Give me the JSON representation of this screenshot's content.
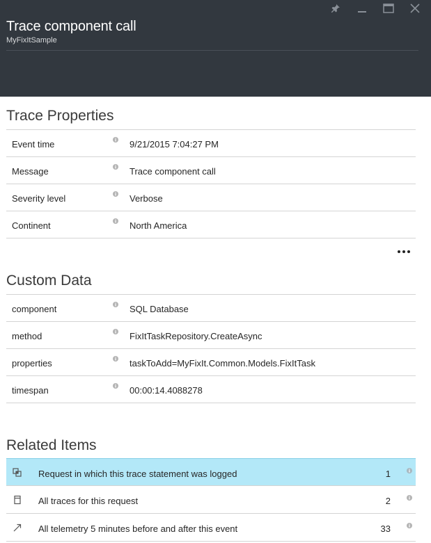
{
  "header": {
    "title": "Trace component call",
    "subtitle": "MyFixItSample",
    "controls": [
      "pin-icon",
      "minimize-icon",
      "maximize-icon",
      "close-icon"
    ]
  },
  "trace_properties": {
    "title": "Trace Properties",
    "rows": [
      {
        "label": "Event time",
        "value": "9/21/2015 7:04:27 PM"
      },
      {
        "label": "Message",
        "value": "Trace component call"
      },
      {
        "label": "Severity level",
        "value": "Verbose"
      },
      {
        "label": "Continent",
        "value": "North America"
      }
    ],
    "more_icon": "ellipsis-icon"
  },
  "custom_data": {
    "title": "Custom Data",
    "rows": [
      {
        "label": "component",
        "value": "SQL Database"
      },
      {
        "label": "method",
        "value": "FixItTaskRepository.CreateAsync"
      },
      {
        "label": "properties",
        "value": "taskToAdd=MyFixIt.Common.Models.FixItTask"
      },
      {
        "label": "timespan",
        "value": "00:00:14.4088278"
      }
    ]
  },
  "related_items": {
    "title": "Related Items",
    "rows": [
      {
        "label": "Request in which this trace statement was logged",
        "count": "1",
        "icon": "request-link-icon",
        "selected": true
      },
      {
        "label": "All traces for this request",
        "count": "2",
        "icon": "document-icon",
        "selected": false
      },
      {
        "label": "All telemetry 5 minutes before and after this event",
        "count": "33",
        "icon": "arrow-up-right-icon",
        "selected": false
      }
    ]
  },
  "colors": {
    "header_bg": "#32383f",
    "selected_row_bg": "#b3e8f8",
    "divider": "#d4d4d4"
  }
}
